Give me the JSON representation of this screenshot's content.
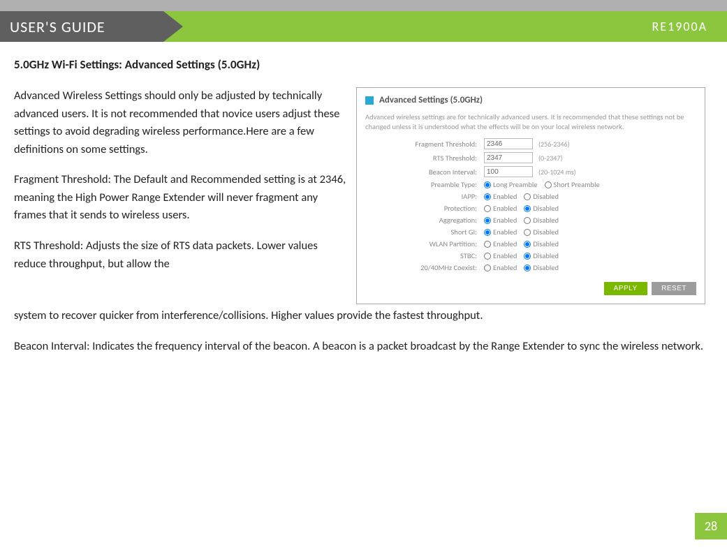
{
  "header": {
    "guide_label": "USER'S GUIDE",
    "model": "RE1900A"
  },
  "section_title": "5.0GHz Wi-Fi Settings: Advanced Settings (5.0GHz)",
  "paragraphs": {
    "intro": "Advanced Wireless Settings should only be adjusted by technically advanced users. It is not recommended that novice users adjust these settings to avoid degrading wireless performance.Here are a few definitions on some settings.",
    "frag": "Fragment Threshold: The Default and Recommended setting is at 2346, meaning the High Power Range Extender will never fragment any frames that it sends to wireless users.",
    "rts_first": "RTS Threshold: Adjusts the size of RTS data packets. Lower values reduce throughput, but allow the",
    "rts_rest": "system to recover quicker from interference/collisions. Higher values provide the fastest throughput.",
    "beacon": "Beacon Interval: Indicates the frequency interval of the beacon. A beacon is a packet broadcast by the Range Extender to sync the wireless network."
  },
  "panel": {
    "title": "Advanced Settings (5.0GHz)",
    "desc": "Advanced wireless settings are for technically advanced users. It is recommended that these settings not be changed unless it is understood what the effects will be on your local wireless network.",
    "fields": {
      "fragment": {
        "label": "Fragment Threshold:",
        "value": "2346",
        "hint": "(256-2346)"
      },
      "rts": {
        "label": "RTS Threshold:",
        "value": "2347",
        "hint": "(0-2347)"
      },
      "beacon": {
        "label": "Beacon Interval:",
        "value": "100",
        "hint": "(20-1024 ms)"
      },
      "preamble": {
        "label": "Preamble Type:",
        "opt1": "Long Preamble",
        "opt2": "Short Preamble",
        "selected": "opt1"
      },
      "iapp": {
        "label": "IAPP:",
        "opt1": "Enabled",
        "opt2": "Disabled",
        "selected": "opt1"
      },
      "protection": {
        "label": "Protection:",
        "opt1": "Enabled",
        "opt2": "Disabled",
        "selected": "opt2"
      },
      "aggregation": {
        "label": "Aggregation:",
        "opt1": "Enabled",
        "opt2": "Disabled",
        "selected": "opt1"
      },
      "shortgi": {
        "label": "Short GI:",
        "opt1": "Enabled",
        "opt2": "Disabled",
        "selected": "opt1"
      },
      "wlanpart": {
        "label": "WLAN Partition:",
        "opt1": "Enabled",
        "opt2": "Disabled",
        "selected": "opt2"
      },
      "stbc": {
        "label": "STBC:",
        "opt1": "Enabled",
        "opt2": "Disabled",
        "selected": "opt2"
      },
      "coexist": {
        "label": "20/40MHz Coexist:",
        "opt1": "Enabled",
        "opt2": "Disabled",
        "selected": "opt2"
      }
    },
    "buttons": {
      "apply": "APPLY",
      "reset": "RESET"
    }
  },
  "page_number": "28"
}
